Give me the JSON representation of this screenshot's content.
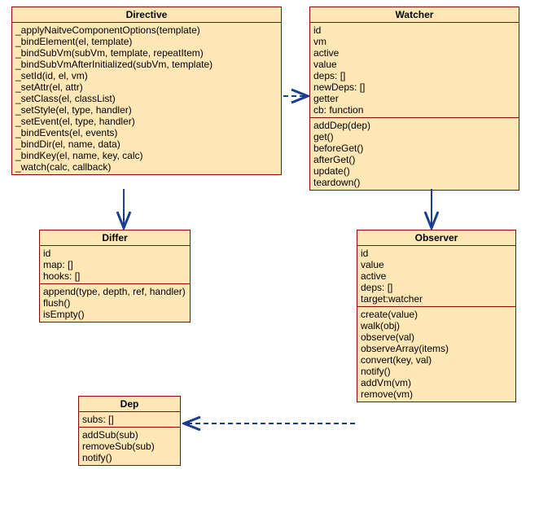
{
  "classes": {
    "directive": {
      "title": "Directive",
      "methods": [
        "_applyNaitveComponentOptions(template)",
        "_bindElement(el, template)",
        "_bindSubVm(subVm, template, repeatItem)",
        "_bindSubVmAfterInitialized(subVm, template)",
        "_setId(id, el, vm)",
        "_setAttr(el, attr)",
        "_setClass(el, classList)",
        "_setStyle(el, type, handler)",
        "_setEvent(el, type, handler)",
        "_bindEvents(el, events)",
        "_bindDir(el, name, data)",
        "_bindKey(el, name, key, calc)",
        "_watch(calc, callback)"
      ]
    },
    "watcher": {
      "title": "Watcher",
      "attributes": [
        "id",
        "vm",
        "active",
        "value",
        "deps: []",
        "newDeps: []",
        "getter",
        "cb: function"
      ],
      "methods": [
        "addDep(dep)",
        "get()",
        "beforeGet()",
        "afterGet()",
        "update()",
        "teardown()"
      ]
    },
    "differ": {
      "title": "Differ",
      "attributes": [
        "id",
        "map: []",
        "hooks: []"
      ],
      "methods": [
        "append(type, depth, ref, handler)",
        "flush()",
        "isEmpty()"
      ]
    },
    "observer": {
      "title": "Observer",
      "attributes": [
        "id",
        "value",
        "active",
        "deps:   []",
        "target:watcher"
      ],
      "methods": [
        "create(value)",
        "walk(obj)",
        "observe(val)",
        "observeArray(items)",
        "convert(key, val)",
        "notify()",
        "addVm(vm)",
        "remove(vm)"
      ]
    },
    "dep": {
      "title": "Dep",
      "attributes": [
        "subs: []"
      ],
      "methods": [
        "addSub(sub)",
        "removeSub(sub)",
        "notify()"
      ]
    }
  }
}
